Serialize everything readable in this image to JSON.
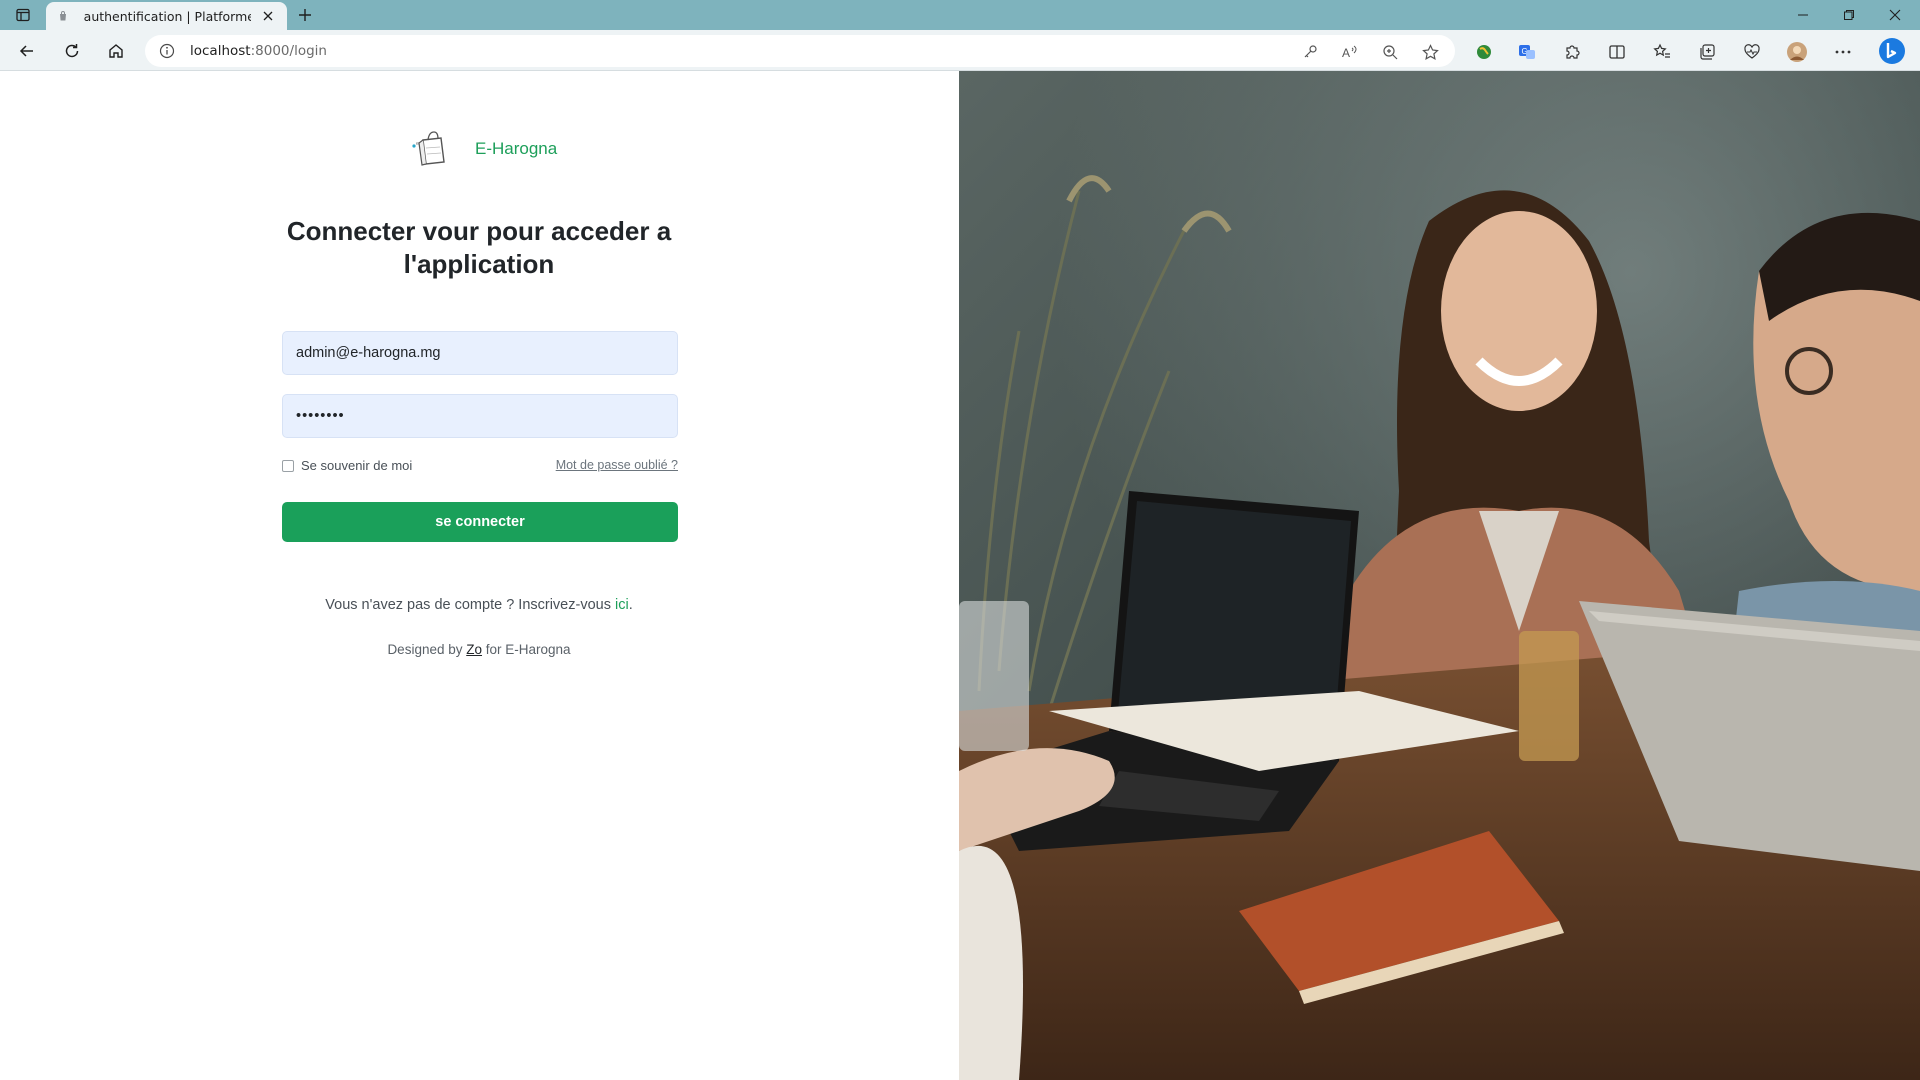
{
  "browser": {
    "tab_title": "authentification | Platforme E-Harogna",
    "url_host": "localhost",
    "url_rest": ":8000/login",
    "window_controls": [
      "minimize",
      "restore",
      "close"
    ]
  },
  "brand": {
    "name": "E-Harogna",
    "logo_icon": "shopping-bag-logo"
  },
  "login": {
    "heading": "Connecter vour pour acceder a l'application",
    "email_value": "admin@e-harogna.mg",
    "password_masked": "••••••••",
    "remember_label": "Se souvenir de moi",
    "forgot_label": "Mot de passe oublié ?",
    "submit_label": "se connecter",
    "signup_prefix": "Vous n'avez pas de compte ? Inscrivez-vous ",
    "signup_link": "ici",
    "signup_suffix": ".",
    "credit_prefix": "Designed by ",
    "credit_author": "Zo",
    "credit_suffix": " for E-Harogna"
  },
  "colors": {
    "accent": "#1aa05a",
    "tabbar": "#7eb3bd",
    "field_bg": "#e8f0fe"
  }
}
